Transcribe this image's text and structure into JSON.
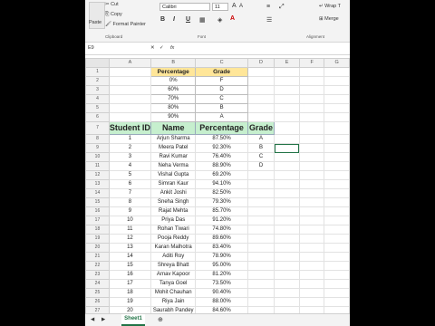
{
  "clipboard": {
    "cut": "Cut",
    "copy": "Copy",
    "format_painter": "Format Painter",
    "paste": "Paste",
    "group": "Clipboard"
  },
  "font": {
    "name": "Calibri",
    "size": "11",
    "group": "Font"
  },
  "alignment": {
    "wrap": "Wrap T",
    "merge": "Merge",
    "group": "Alignment"
  },
  "name_box": "E9",
  "fx_label": "fx",
  "columns": [
    "A",
    "B",
    "C",
    "D",
    "E",
    "F",
    "G"
  ],
  "rows": [
    "1",
    "2",
    "3",
    "4",
    "5",
    "6",
    "7",
    "8",
    "9",
    "10",
    "11",
    "12",
    "13",
    "14",
    "15",
    "16",
    "17",
    "18",
    "19",
    "20",
    "21",
    "22",
    "23",
    "24",
    "25",
    "26",
    "27"
  ],
  "lookup": {
    "header": [
      "Percentage",
      "Grade"
    ],
    "rows": [
      [
        "0%",
        "F"
      ],
      [
        "60%",
        "D"
      ],
      [
        "70%",
        "C"
      ],
      [
        "80%",
        "B"
      ],
      [
        "90%",
        "A"
      ]
    ]
  },
  "students": {
    "header": [
      "Student ID",
      "Name",
      "Percentage",
      "Grade"
    ],
    "rows": [
      [
        "1",
        "Arjun Sharma",
        "87.50%",
        "A"
      ],
      [
        "2",
        "Meera Patel",
        "92.30%",
        "B"
      ],
      [
        "3",
        "Ravi Kumar",
        "76.40%",
        "C"
      ],
      [
        "4",
        "Neha Verma",
        "88.90%",
        "D"
      ],
      [
        "5",
        "Vishal Gupta",
        "69.20%",
        ""
      ],
      [
        "6",
        "Simran Kaur",
        "94.10%",
        ""
      ],
      [
        "7",
        "Ankit Joshi",
        "82.50%",
        ""
      ],
      [
        "8",
        "Sneha Singh",
        "79.30%",
        ""
      ],
      [
        "9",
        "Rajat Mehta",
        "85.70%",
        ""
      ],
      [
        "10",
        "Priya Das",
        "91.20%",
        ""
      ],
      [
        "11",
        "Rohan Tiwari",
        "74.80%",
        ""
      ],
      [
        "12",
        "Pooja Reddy",
        "89.60%",
        ""
      ],
      [
        "13",
        "Karan Malhotra",
        "83.40%",
        ""
      ],
      [
        "14",
        "Aditi Roy",
        "78.90%",
        ""
      ],
      [
        "15",
        "Shreya Bhatt",
        "95.00%",
        ""
      ],
      [
        "16",
        "Arnav Kapoor",
        "81.20%",
        ""
      ],
      [
        "17",
        "Tanya Goel",
        "73.50%",
        ""
      ],
      [
        "18",
        "Mohit Chauhan",
        "90.40%",
        ""
      ],
      [
        "19",
        "Riya Jain",
        "88.00%",
        ""
      ],
      [
        "20",
        "Saurabh Pandey",
        "84.60%",
        ""
      ]
    ]
  },
  "sheet_tab": "Sheet1",
  "colors": {
    "lookup_header": "#ffe699",
    "student_header": "#c6efce",
    "accent": "#217346"
  }
}
